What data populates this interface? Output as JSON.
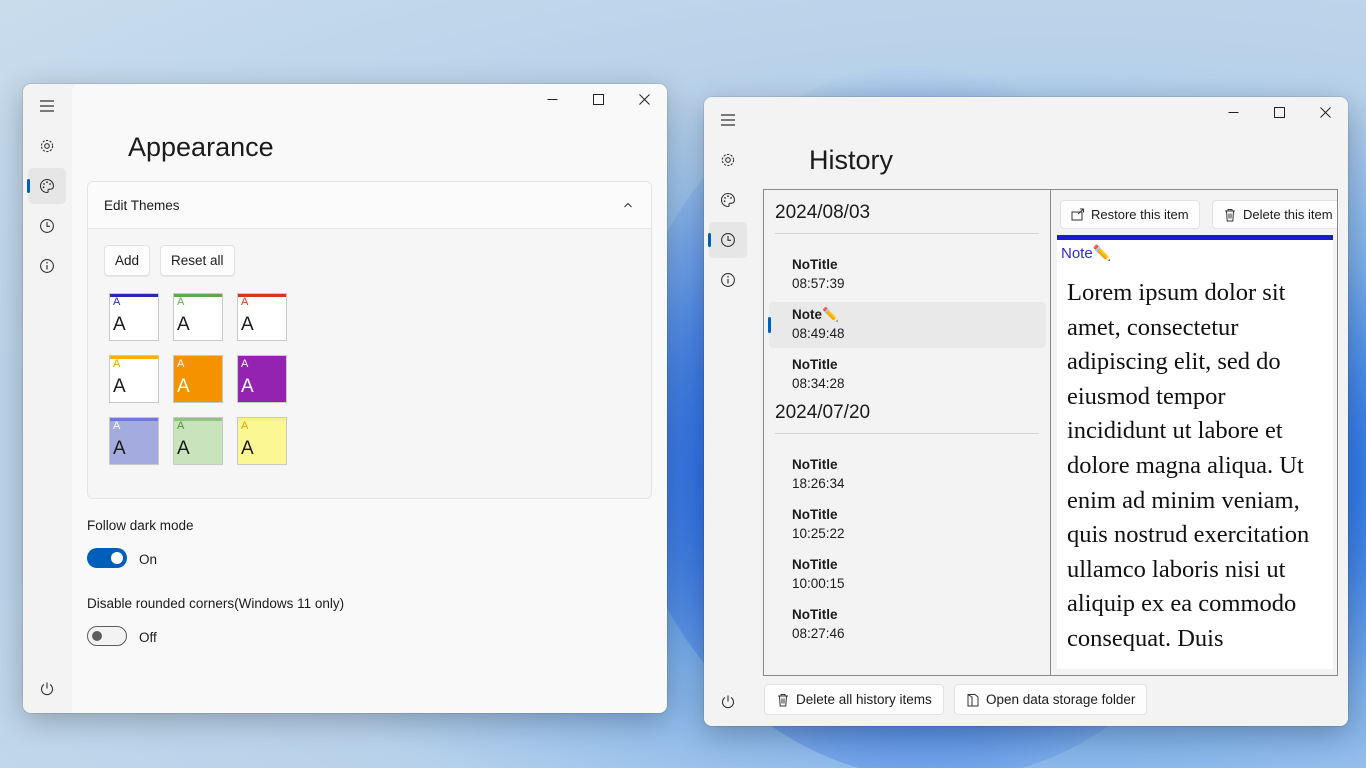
{
  "appearance_window": {
    "title": "Appearance",
    "expander": {
      "header": "Edit Themes",
      "add_label": "Add",
      "reset_label": "Reset all",
      "themes": [
        {
          "small": "A",
          "big": "A",
          "bar": "#2a2aa8",
          "bg": "#ffffff",
          "fg": "#1b1b1b",
          "smallColor": "#2a2aa8"
        },
        {
          "small": "A",
          "big": "A",
          "bar": "#5fa64f",
          "bg": "#ffffff",
          "fg": "#1b1b1b",
          "smallColor": "#5fa64f"
        },
        {
          "small": "A",
          "big": "A",
          "bar": "#d0381f",
          "bg": "#ffffff",
          "fg": "#1b1b1b",
          "smallColor": "#d0381f"
        },
        {
          "small": "A",
          "big": "A",
          "bar": "#f0b400",
          "bg": "#ffffff",
          "fg": "#1b1b1b",
          "smallColor": "#e8a200"
        },
        {
          "small": "A",
          "big": "A",
          "bar": "#f59200",
          "bg": "#f59200",
          "fg": "#ffffff",
          "smallColor": "#ffffff"
        },
        {
          "small": "A",
          "big": "A",
          "bar": "#9323b0",
          "bg": "#9323b0",
          "fg": "#ffffff",
          "smallColor": "#ffffff"
        },
        {
          "small": "A",
          "big": "A",
          "bar": "#6d7bd0",
          "bg": "#a4acdf",
          "fg": "#1b1b1b",
          "smallColor": "#ffffff"
        },
        {
          "small": "A",
          "big": "A",
          "bar": "#8fc57e",
          "bg": "#c9e4bc",
          "fg": "#1b1b1b",
          "smallColor": "#4c9a3a"
        },
        {
          "small": "A",
          "big": "A",
          "bar": "#f7f090",
          "bg": "#fbf894",
          "fg": "#1b1b1b",
          "smallColor": "#e8a200"
        }
      ]
    },
    "follow_dark_mode": {
      "label": "Follow dark mode",
      "state": "On"
    },
    "rounded_corners": {
      "label": "Disable rounded corners(Windows 11 only)",
      "state": "Off"
    }
  },
  "history_window": {
    "title": "History",
    "restore_label": "Restore this item",
    "delete_label": "Delete this item",
    "groups": [
      {
        "date": "2024/08/03",
        "items": [
          {
            "title": "NoTitle",
            "time": "08:57:39"
          },
          {
            "title": "Note✏️",
            "time": "08:49:48",
            "selected": true
          },
          {
            "title": "NoTitle",
            "time": "08:34:28"
          }
        ]
      },
      {
        "date": "2024/07/20",
        "items": [
          {
            "title": "NoTitle",
            "time": "18:26:34"
          },
          {
            "title": "NoTitle",
            "time": "10:25:22"
          },
          {
            "title": "NoTitle",
            "time": "10:00:15"
          },
          {
            "title": "NoTitle",
            "time": "08:27:46"
          }
        ]
      }
    ],
    "note": {
      "title": "Note✏️",
      "body": "Lorem ipsum dolor sit amet, consectetur adipiscing elit, sed do eiusmod tempor incididunt ut labore et dolore magna aliqua. Ut enim ad minim veniam, quis nostrud exercitation ullamco laboris nisi ut aliquip ex ea commodo consequat. Duis"
    },
    "delete_all_label": "Delete all history items",
    "open_folder_label": "Open data storage folder"
  },
  "colors": {
    "accent": "#005fb8",
    "note_accent": "#1a1ad1"
  }
}
